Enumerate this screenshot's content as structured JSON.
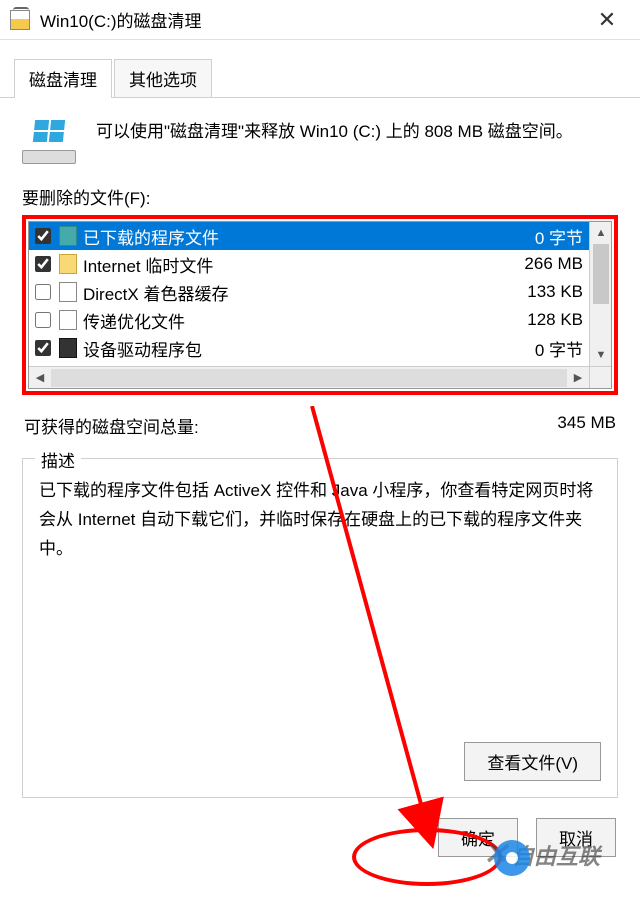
{
  "title": "Win10(C:)的磁盘清理",
  "tabs": {
    "active": "磁盘清理",
    "other": "其他选项"
  },
  "intro": "可以使用\"磁盘清理\"来释放 Win10 (C:) 上的 808 MB 磁盘空间。",
  "filesLabel": "要删除的文件(F):",
  "fileList": [
    {
      "checked": true,
      "name": "已下载的程序文件",
      "size": "0 字节",
      "icon": "folder",
      "selected": true
    },
    {
      "checked": true,
      "name": "Internet 临时文件",
      "size": "266 MB",
      "icon": "lock",
      "selected": false
    },
    {
      "checked": false,
      "name": "DirectX 着色器缓存",
      "size": "133 KB",
      "icon": "file",
      "selected": false
    },
    {
      "checked": false,
      "name": "传递优化文件",
      "size": "128 KB",
      "icon": "file",
      "selected": false
    },
    {
      "checked": true,
      "name": "设备驱动程序包",
      "size": "0 字节",
      "icon": "dark",
      "selected": false
    }
  ],
  "total": {
    "label": "可获得的磁盘空间总量:",
    "value": "345 MB"
  },
  "desc": {
    "legend": "描述",
    "text": "已下载的程序文件包括 ActiveX 控件和 Java 小程序，你查看特定网页时将会从 Internet 自动下载它们，并临时保存在硬盘上的已下载的程序文件夹中。"
  },
  "buttons": {
    "viewFiles": "查看文件(V)",
    "ok": "确定",
    "cancel": "取消"
  },
  "watermark": "自由互联"
}
